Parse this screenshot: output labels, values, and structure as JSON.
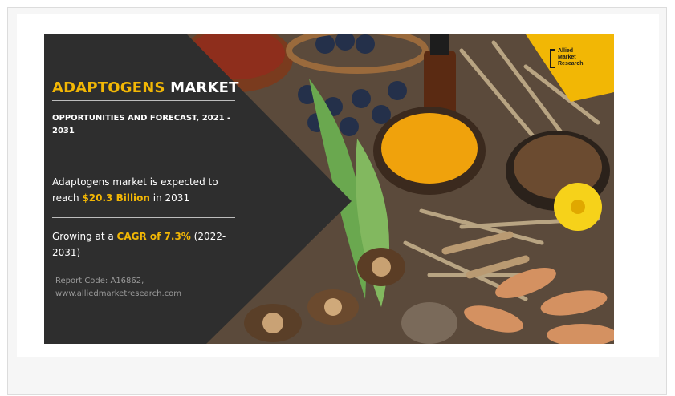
{
  "banner": {
    "title_main": "ADAPTOGENS",
    "title_rest": " MARKET",
    "subtitle": "OPPORTUNITIES AND FORECAST, 2021 - 2031",
    "stat1": {
      "pre": "Adaptogens market is expected to reach ",
      "highlight": "$20.3 Billion",
      "post": " in 2031"
    },
    "stat2": {
      "pre": "Growing at a ",
      "highlight": "CAGR of 7.3%",
      "post": " (2022-2031)"
    },
    "report_code": "Report Code: A16862,",
    "website": "www.alliedmarketresearch.com",
    "logo": {
      "line1": "Allied",
      "line2": "Market",
      "line3": "Research"
    }
  },
  "colors": {
    "accent": "#f2b705",
    "panel": "#2e2e2e"
  },
  "photo_description_icons": [
    "bowl-icon",
    "turmeric-icon",
    "aloe-leaf-icon",
    "mushroom-icon",
    "root-icon",
    "flower-icon"
  ]
}
